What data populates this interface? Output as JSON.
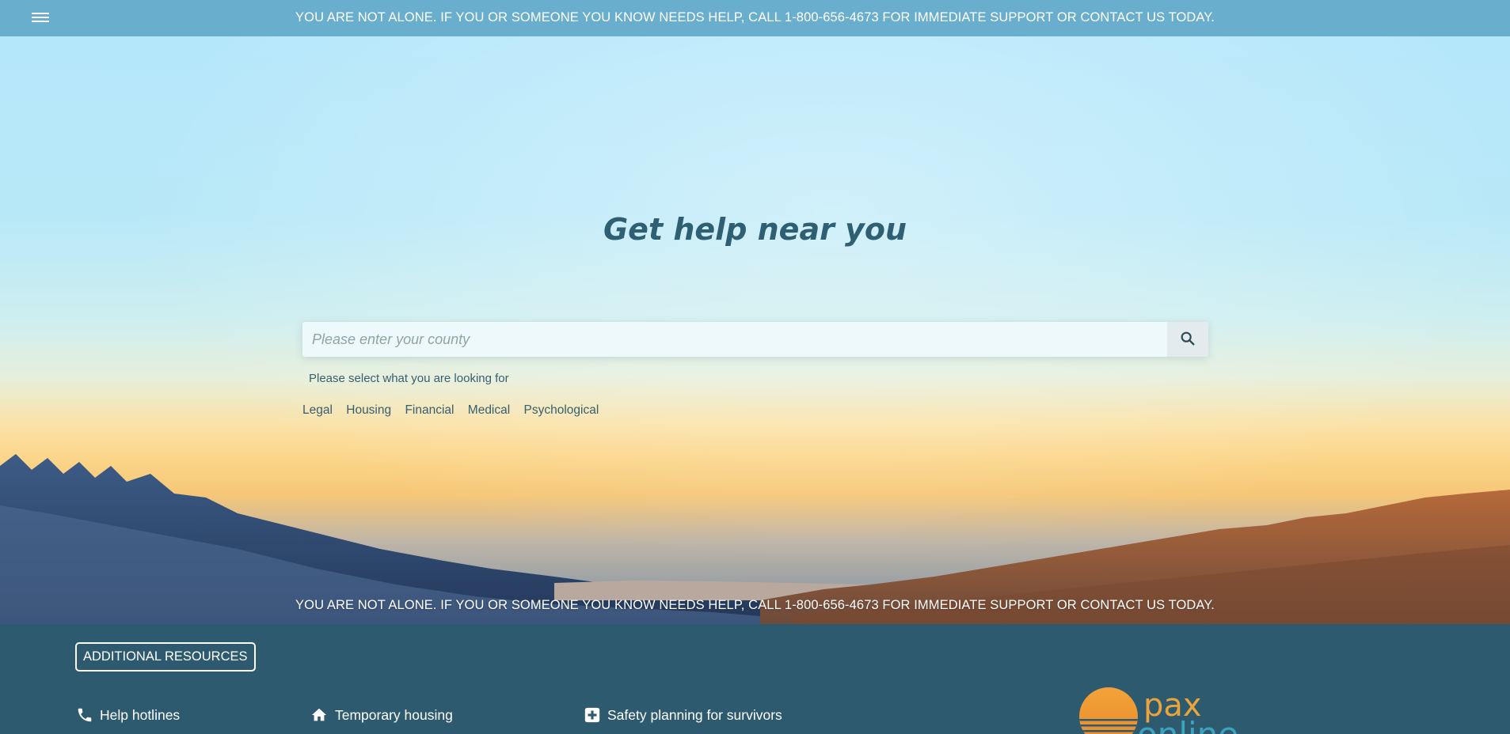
{
  "banner": {
    "text": "YOU ARE NOT ALONE. IF YOU OR SOMEONE YOU KNOW NEEDS HELP, CALL 1-800-656-4673 FOR IMMEDIATE SUPPORT OR CONTACT US TODAY."
  },
  "hero": {
    "title": "Get help near you",
    "search": {
      "placeholder": "Please enter your county",
      "value": ""
    },
    "select_label": "Please select what you are looking for",
    "categories": [
      "Legal",
      "Housing",
      "Financial",
      "Medical",
      "Psychological"
    ],
    "bottom_text": "YOU ARE NOT ALONE. IF YOU OR SOMEONE YOU KNOW NEEDS HELP, CALL 1-800-656-4673 FOR IMMEDIATE SUPPORT OR CONTACT US TODAY."
  },
  "footer": {
    "additional_resources": "ADDITIONAL RESOURCES",
    "items": [
      {
        "label": "Help hotlines",
        "icon": "phone-icon"
      },
      {
        "label": "Temporary housing",
        "icon": "home-icon"
      },
      {
        "label": "Safety planning for survivors",
        "icon": "medical-plus-icon"
      }
    ],
    "logo_text": "pax online"
  },
  "colors": {
    "banner": "#6aaecd",
    "footer": "#2e5a6f",
    "title": "#2f5f73",
    "logo_orange": "#f0a030",
    "logo_teal": "#3ba3c0"
  }
}
